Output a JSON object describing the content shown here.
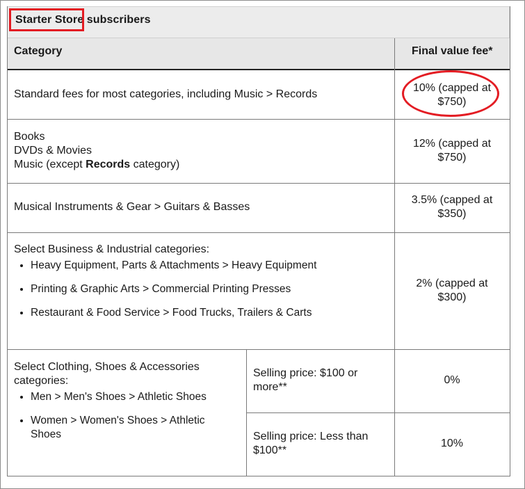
{
  "title": {
    "bold": "Starter Store",
    "rest": " subscribers"
  },
  "headers": {
    "category": "Category",
    "fee": "Final value fee*"
  },
  "rows": [
    {
      "category": "Standard fees for most categories, including Music > Records",
      "fee_line1": "10% (capped at",
      "fee_line2": "$750)"
    },
    {
      "lines": [
        "Books",
        "DVDs & Movies"
      ],
      "music_pre": "Music (except ",
      "music_bold": "Records",
      "music_post": " category)",
      "fee_line1": "12% (capped at",
      "fee_line2": "$750)"
    },
    {
      "category": "Musical Instruments & Gear > Guitars & Basses",
      "fee_line1": "3.5% (capped at",
      "fee_line2": "$350)"
    },
    {
      "intro": "Select Business & Industrial categories:",
      "items": [
        "Heavy Equipment, Parts & Attachments > Heavy Equipment",
        "Printing & Graphic Arts > Commercial Printing Presses",
        "Restaurant & Food Service > Food Trucks, Trailers & Carts"
      ],
      "fee_line1": "2% (capped at",
      "fee_line2": "$300)"
    },
    {
      "intro_line1": "Select Clothing, Shoes & Accessories",
      "intro_line2": "categories:",
      "items": [
        "Men > Men's Shoes > Athletic Shoes",
        "Women > Women's Shoes > Athletic",
        "Shoes"
      ],
      "sub": [
        {
          "price_line1": "Selling price: $100 or",
          "price_line2": "more**",
          "fee": "0%"
        },
        {
          "price_line1": "Selling price: Less than",
          "price_line2": "$100**",
          "fee": "10%"
        }
      ]
    }
  ],
  "annotations": {
    "highlight_color": "#e31c23"
  }
}
